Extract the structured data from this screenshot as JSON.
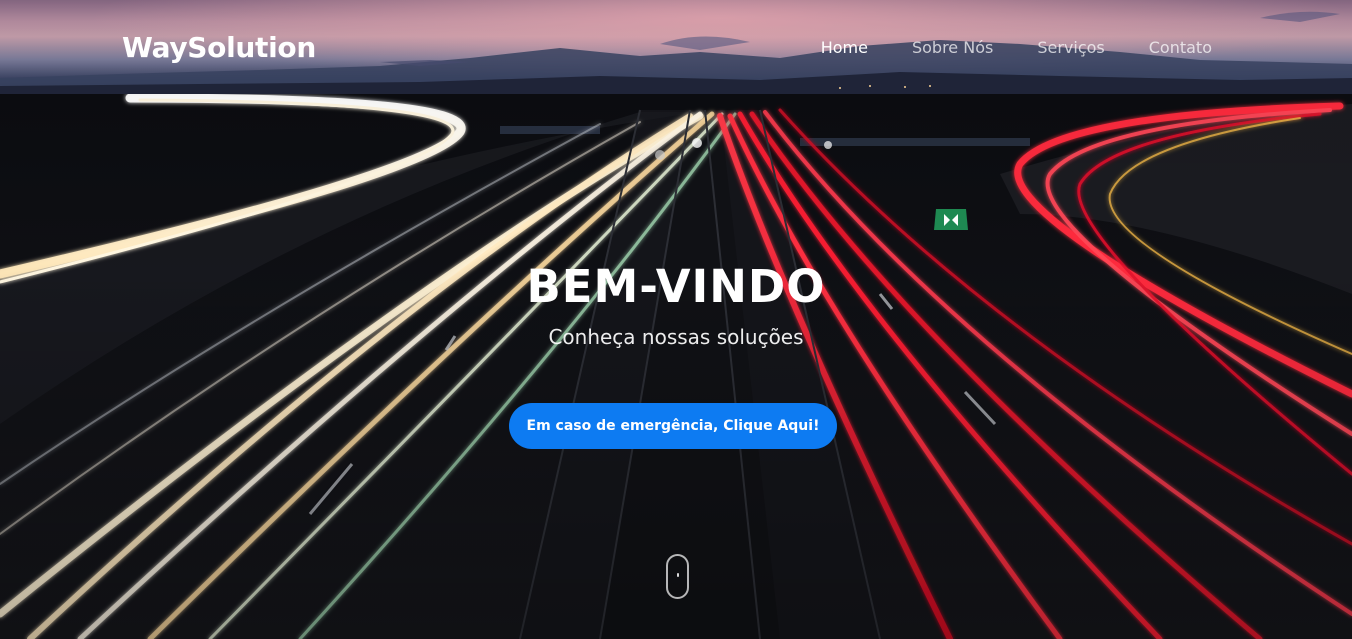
{
  "navbar": {
    "brand": "WaySolution",
    "links": [
      {
        "label": "Home",
        "active": true
      },
      {
        "label": "Sobre Nós",
        "active": false
      },
      {
        "label": "Serviços",
        "active": false
      },
      {
        "label": "Contato",
        "active": false
      }
    ]
  },
  "hero": {
    "title": "BEM-VINDO",
    "subtitle": "Conheça nossas soluções",
    "cta_label": "Em caso de emergência, Clique Aqui!"
  },
  "colors": {
    "accent": "#0d7bf2",
    "text": "#ffffff"
  },
  "icons": {
    "scroll_indicator": "mouse-scroll-icon"
  }
}
